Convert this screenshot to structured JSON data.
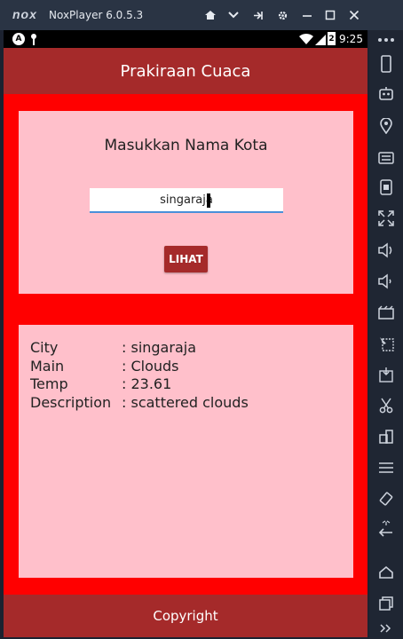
{
  "emulator": {
    "logo": "nox",
    "title": "NoxPlayer 6.0.5.3",
    "controls": [
      "home-icon",
      "chevron-down-icon",
      "pin-icon",
      "gear-icon",
      "minimize-icon",
      "maximize-icon",
      "close-icon"
    ],
    "sidebar_icons": [
      "phone-rotate-icon",
      "robot-icon",
      "location-icon",
      "keyboard-icon",
      "screenshot-icon",
      "fullscreen-icon",
      "volume-up-icon",
      "volume-down-icon",
      "video-icon",
      "multi-select-icon",
      "apk-icon",
      "scissors-icon",
      "multi-instance-icon",
      "menu-icon",
      "shake-icon",
      "back-icon",
      "home-icon",
      "recent-apps-icon",
      "more-icon"
    ]
  },
  "statusbar": {
    "time": "9:25",
    "battery": "2"
  },
  "app": {
    "title": "Prakiraan Cuaca",
    "prompt": "Masukkan Nama Kota",
    "city_input_value": "singaraja",
    "button_label": "LIHAT",
    "results": [
      {
        "label": "City",
        "value": ": singaraja"
      },
      {
        "label": "Main",
        "value": ": Clouds"
      },
      {
        "label": "Temp",
        "value": ": 23.61"
      },
      {
        "label": "Description",
        "value": ": scattered clouds"
      }
    ],
    "footer": "Copyright"
  },
  "colors": {
    "primary": "#a52a2a",
    "background": "#ff0000",
    "card": "#ffc0cb"
  }
}
